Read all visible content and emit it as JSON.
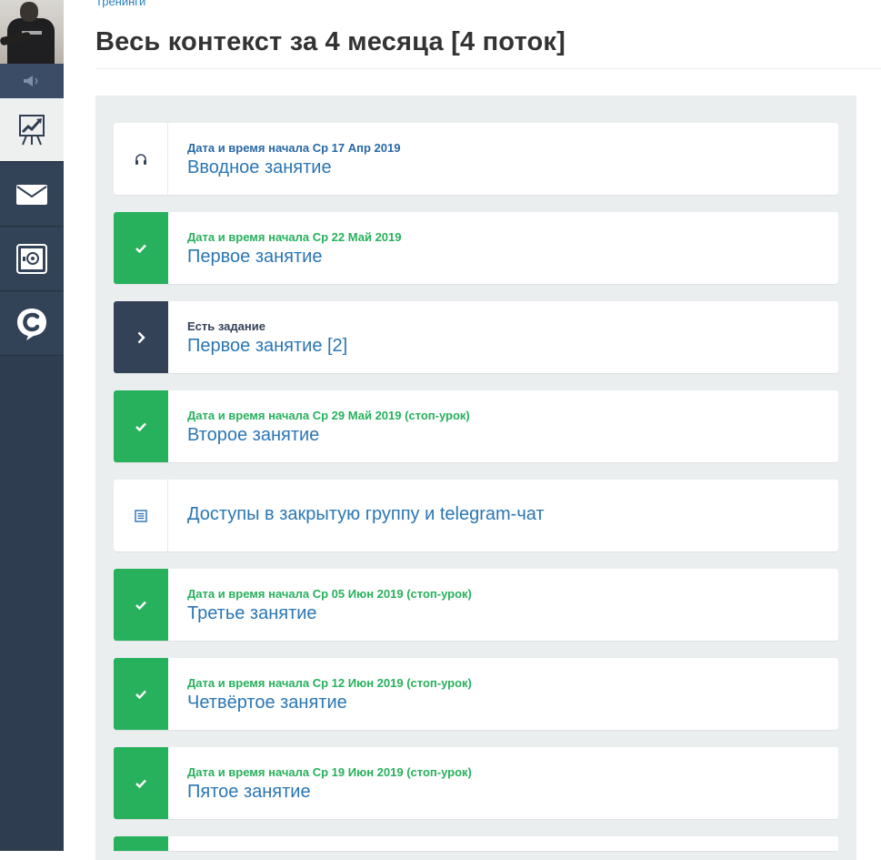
{
  "header": {
    "breadcrumb": "Тренинги",
    "title": "Весь контекст за 4 месяца [4 поток]"
  },
  "sidebar": {
    "items": [
      {
        "icon": "speaker-icon"
      },
      {
        "icon": "chart-board-icon",
        "active": true
      },
      {
        "icon": "mail-icon"
      },
      {
        "icon": "safe-icon"
      },
      {
        "icon": "brand-c-chat-icon"
      }
    ]
  },
  "lessons": [
    {
      "meta": "Дата и время начала Ср 17 Апр 2019",
      "name": "Вводное занятие",
      "status": "audio",
      "icon": "headphones-icon"
    },
    {
      "meta": "Дата и время начала Ср 22 Май 2019",
      "name": "Первое занятие",
      "status": "done",
      "icon": "check-icon"
    },
    {
      "meta": "Есть задание",
      "name": "Первое занятие [2]",
      "status": "task",
      "icon": "chevron-right-icon"
    },
    {
      "meta": "Дата и время начала Ср 29 Май 2019 (стоп-урок)",
      "name": "Второе занятие",
      "status": "done",
      "icon": "check-icon"
    },
    {
      "meta": "",
      "name": "Доступы в закрытую группу и telegram-чат",
      "status": "text",
      "icon": "document-icon"
    },
    {
      "meta": "Дата и время начала Ср 05 Июн 2019 (стоп-урок)",
      "name": "Третье занятие",
      "status": "done",
      "icon": "check-icon"
    },
    {
      "meta": "Дата и время начала Ср 12 Июн 2019 (стоп-урок)",
      "name": "Четвёртое занятие",
      "status": "done",
      "icon": "check-icon"
    },
    {
      "meta": "Дата и время начала Ср 19 Июн 2019 (стоп-урок)",
      "name": "Пятое занятие",
      "status": "done",
      "icon": "check-icon"
    }
  ],
  "colors": {
    "sidebar": "#2f3d50",
    "done": "#27b15c",
    "task": "#344257",
    "link": "#2b76b4",
    "panel": "#ebeeef"
  }
}
